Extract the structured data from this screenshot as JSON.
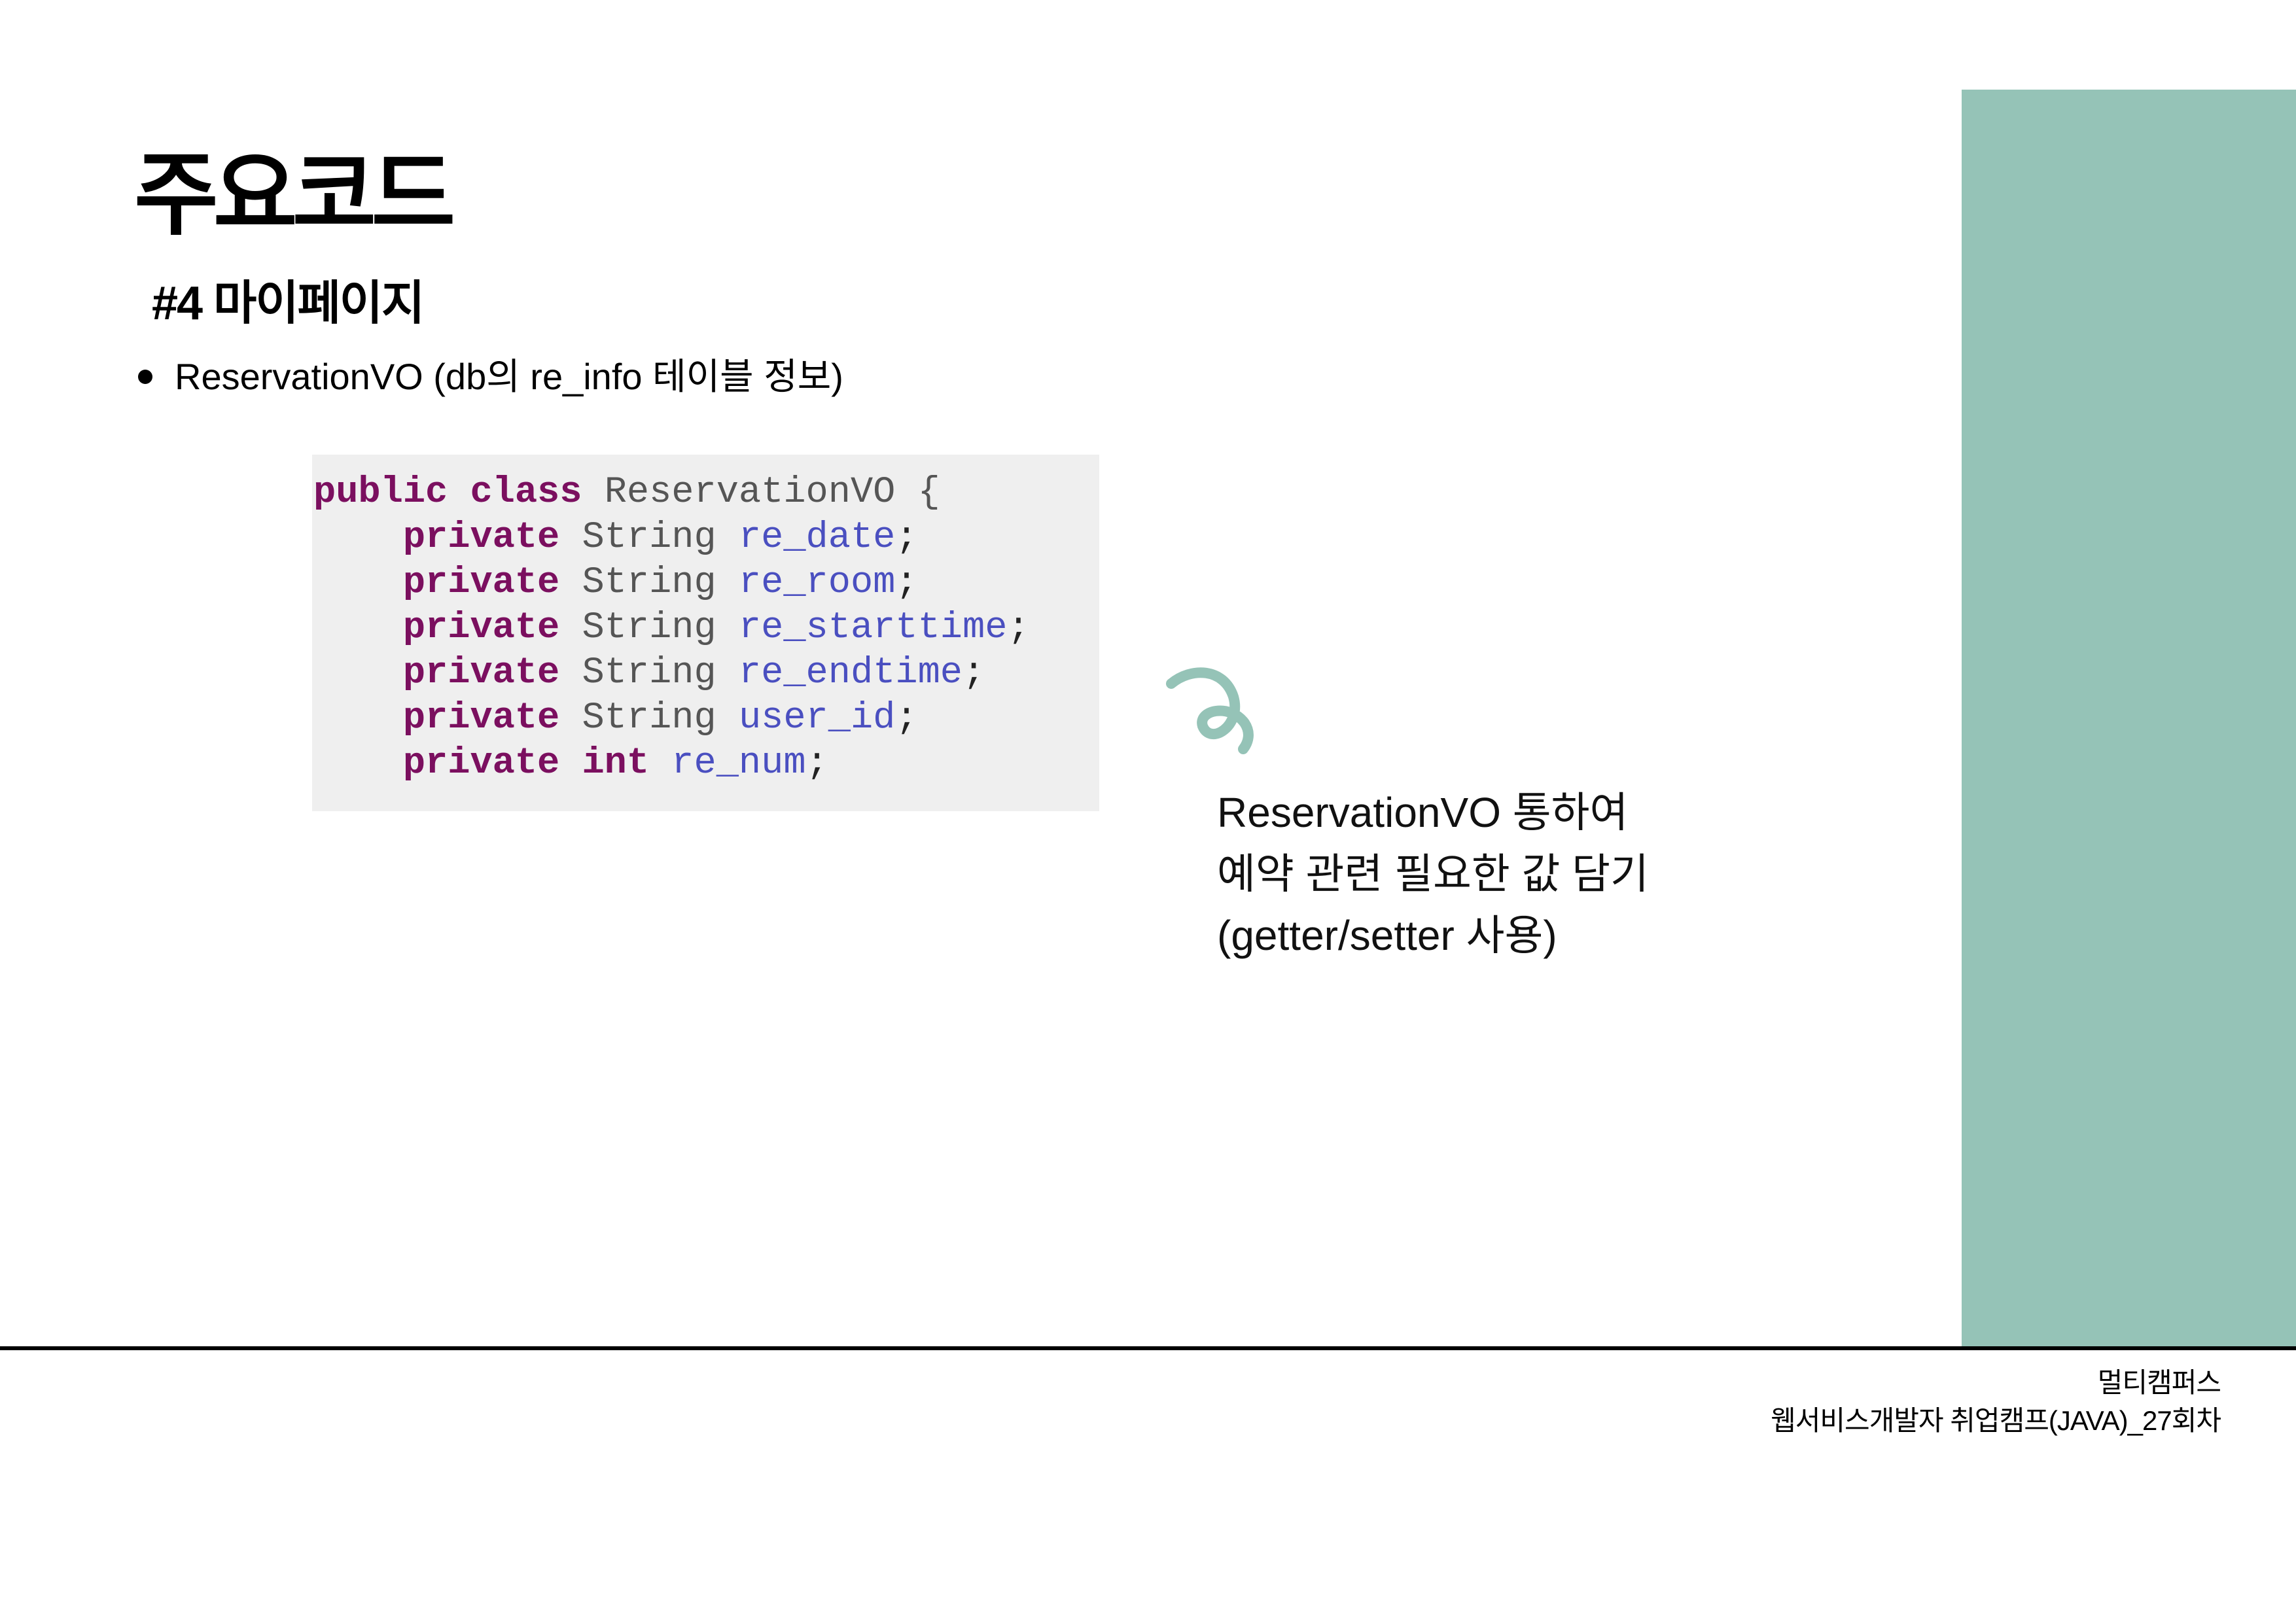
{
  "slide": {
    "title": "주요코드",
    "subtitle": "#4 마이페이지",
    "bullet": "ReservationVO (db의 re_info 테이블 정보)"
  },
  "code": {
    "lines": [
      [
        {
          "t": "kw",
          "v": "public class "
        },
        {
          "t": "ty",
          "v": "ReservationVO {"
        }
      ],
      [
        {
          "t": "ty",
          "v": "    "
        },
        {
          "t": "kw",
          "v": "private "
        },
        {
          "t": "ty",
          "v": "String "
        },
        {
          "t": "fd",
          "v": "re_date"
        },
        {
          "t": "pn",
          "v": ";"
        }
      ],
      [
        {
          "t": "ty",
          "v": "    "
        },
        {
          "t": "kw",
          "v": "private "
        },
        {
          "t": "ty",
          "v": "String "
        },
        {
          "t": "fd",
          "v": "re_room"
        },
        {
          "t": "pn",
          "v": ";"
        }
      ],
      [
        {
          "t": "ty",
          "v": "    "
        },
        {
          "t": "kw",
          "v": "private "
        },
        {
          "t": "ty",
          "v": "String "
        },
        {
          "t": "fd",
          "v": "re_starttime"
        },
        {
          "t": "pn",
          "v": ";"
        }
      ],
      [
        {
          "t": "ty",
          "v": "    "
        },
        {
          "t": "kw",
          "v": "private "
        },
        {
          "t": "ty",
          "v": "String "
        },
        {
          "t": "fd",
          "v": "re_endtime"
        },
        {
          "t": "pn",
          "v": ";"
        }
      ],
      [
        {
          "t": "ty",
          "v": "    "
        },
        {
          "t": "kw",
          "v": "private "
        },
        {
          "t": "ty",
          "v": "String "
        },
        {
          "t": "fd",
          "v": "user_id"
        },
        {
          "t": "pn",
          "v": ";"
        }
      ],
      [
        {
          "t": "ty",
          "v": "    "
        },
        {
          "t": "kw",
          "v": "private int "
        },
        {
          "t": "fd",
          "v": "re_num"
        },
        {
          "t": "pn",
          "v": ";"
        }
      ]
    ]
  },
  "note": {
    "line1": "ReservationVO 통하여",
    "line2": "예약 관련 필요한 값 담기",
    "line3": "(getter/setter 사용)"
  },
  "footer": {
    "line1": "멀티캠퍼스",
    "line2": "웹서비스개발자 취업캠프(JAVA)_27회차"
  },
  "colors": {
    "accent": "#95c3b7",
    "keyword": "#7b0f5f",
    "field": "#4a4fc0",
    "code_background": "#efefef"
  },
  "icons": {
    "squiggle": "squiggle-decoration-icon",
    "bullet": "bullet-dot-icon"
  }
}
